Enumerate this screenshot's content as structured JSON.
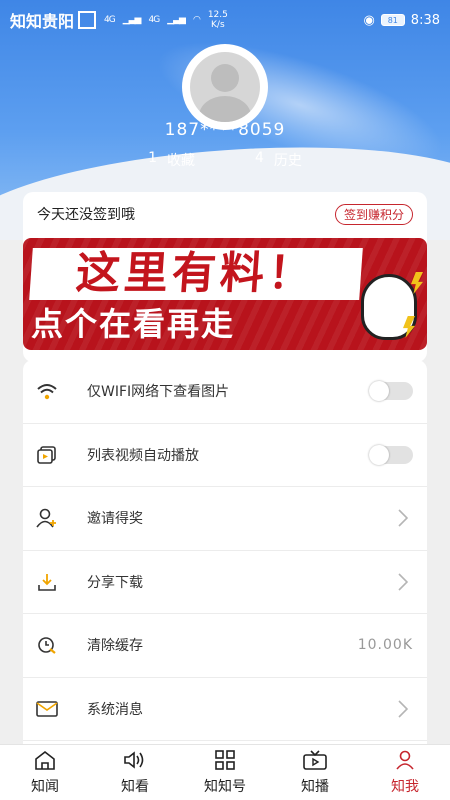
{
  "status_bar": {
    "app_name": "知知贵阳",
    "signal": "4G",
    "speed_value": "12.5",
    "speed_unit": "K/s",
    "battery": "81",
    "time": "8:38"
  },
  "profile": {
    "phone": "187****8059",
    "favorites_count": "1",
    "favorites_label": "收藏",
    "history_count": "4",
    "history_label": "历史"
  },
  "sign": {
    "text": "今天还没签到哦",
    "button": "签到赚积分"
  },
  "banner": {
    "line1": "这里有料！",
    "line2": "点个在看再走"
  },
  "menu": {
    "items": [
      {
        "label": "仅WIFI网络下查看图片",
        "icon": "wifi-icon"
      },
      {
        "label": "列表视频自动播放",
        "icon": "video-play-icon"
      },
      {
        "label": "邀请得奖",
        "icon": "add-user-icon"
      },
      {
        "label": "分享下载",
        "icon": "download-icon"
      },
      {
        "label": "清除缓存",
        "icon": "clock-clear-icon",
        "value": "10.00K"
      },
      {
        "label": "系统消息",
        "icon": "mail-icon"
      }
    ],
    "toggles": {
      "wifi_only": false,
      "autoplay": false
    }
  },
  "tabbar": {
    "tabs": [
      {
        "label": "知闻",
        "icon": "home-icon"
      },
      {
        "label": "知看",
        "icon": "speaker-icon"
      },
      {
        "label": "知知号",
        "icon": "grid-icon"
      },
      {
        "label": "知播",
        "icon": "tv-icon"
      },
      {
        "label": "知我",
        "icon": "user-icon"
      }
    ],
    "active": "知我"
  },
  "colors": {
    "accent": "#c6262e",
    "header_blue": "#3f86e6"
  }
}
